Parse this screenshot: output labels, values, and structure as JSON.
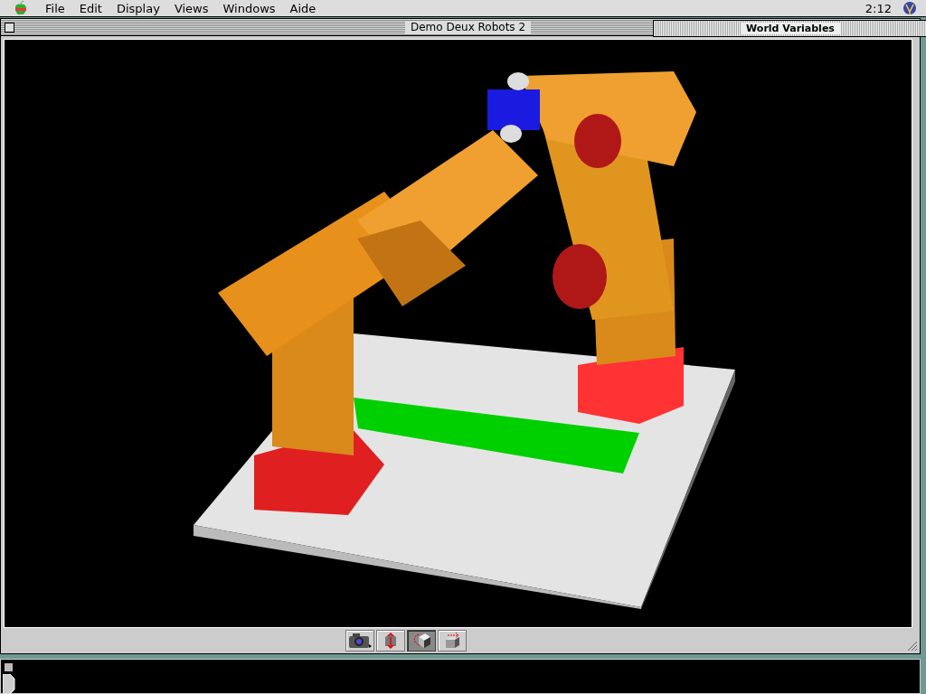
{
  "menu_bar": {
    "items": [
      "File",
      "Edit",
      "Display",
      "Views",
      "Windows",
      "Aide"
    ],
    "clock": "2:12"
  },
  "main_window": {
    "title": "Demo Deux Robots 2",
    "tools": [
      {
        "kind": "camera",
        "selected": false
      },
      {
        "kind": "lift",
        "selected": false
      },
      {
        "kind": "rotate",
        "selected": true
      },
      {
        "kind": "move",
        "selected": false
      }
    ]
  },
  "variables_window": {
    "title": "World Variables"
  }
}
